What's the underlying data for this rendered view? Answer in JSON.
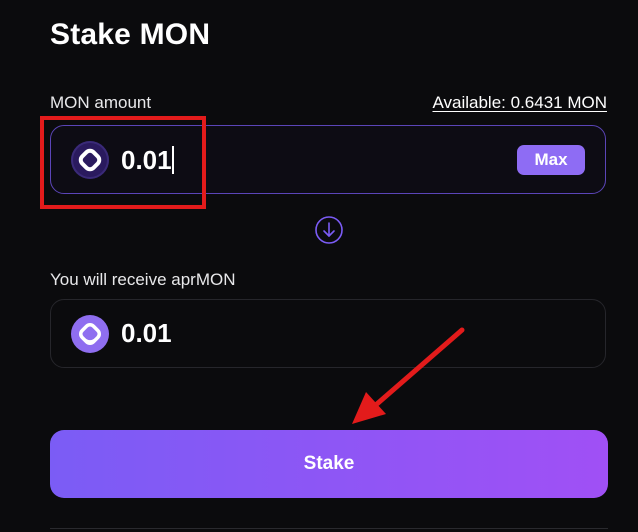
{
  "page": {
    "title": "Stake MON"
  },
  "input": {
    "label": "MON amount",
    "available": "Available: 0.6431 MON",
    "value": "0.01",
    "max_label": "Max",
    "token_icon": "mon-token-icon"
  },
  "output": {
    "label": "You will receive aprMON",
    "value": "0.01",
    "token_icon": "aprmon-token-icon"
  },
  "swap_direction_icon": "arrow-down-circle-icon",
  "stake_button": {
    "label": "Stake"
  },
  "annotations": {
    "highlight_color": "#e31b1b",
    "arrow_color": "#e31b1b"
  },
  "colors": {
    "accent": "#8e6cf4",
    "button_gradient_start": "#7b5cf5",
    "button_gradient_end": "#a050f5",
    "background": "#0b0b0d"
  }
}
